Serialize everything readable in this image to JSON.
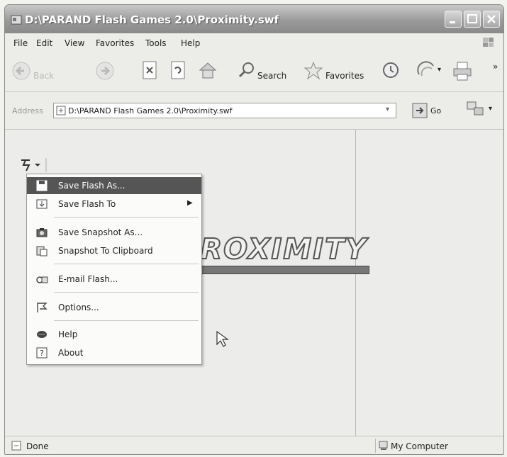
{
  "window": {
    "title": "D:\\PARAND Flash Games 2.0\\Proximity.swf"
  },
  "menubar": {
    "items": [
      "File",
      "Edit",
      "View",
      "Favorites",
      "Tools",
      "Help"
    ]
  },
  "toolbar": {
    "back_label": "Back",
    "search_label": "Search",
    "favorites_label": "Favorites",
    "chevron": "»"
  },
  "address": {
    "label": "Address",
    "value": "D:\\PARAND Flash Games 2.0\\Proximity.swf",
    "go_label": "Go"
  },
  "content": {
    "logo_text": "PROXIMITY"
  },
  "context_menu": {
    "items": [
      {
        "label": "Save Flash As...",
        "icon": "floppy-disk-icon",
        "selected": true
      },
      {
        "label": "Save Flash To",
        "icon": "folder-save-icon",
        "has_submenu": true
      },
      {
        "label": "Save Snapshot As...",
        "icon": "camera-icon"
      },
      {
        "label": "Snapshot To Clipboard",
        "icon": "clipboard-icon"
      },
      {
        "label": "E-mail Flash...",
        "icon": "email-icon"
      },
      {
        "label": "Options...",
        "icon": "options-icon"
      },
      {
        "label": "Help",
        "icon": "help-book-icon"
      },
      {
        "label": "About",
        "icon": "question-icon"
      }
    ]
  },
  "status": {
    "left": "Done",
    "right": "My Computer"
  },
  "colors": {
    "menu_highlight": "#555555",
    "title_bar": "#9a9a9a"
  }
}
